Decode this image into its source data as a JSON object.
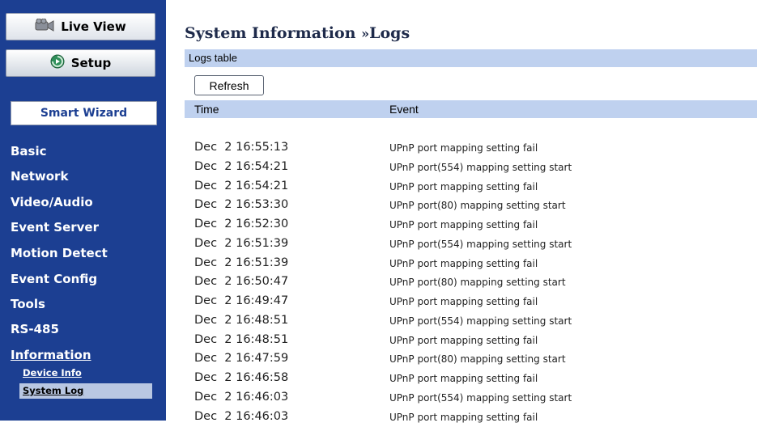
{
  "sidebar": {
    "live_view": "Live View",
    "setup": "Setup",
    "smart_wizard": "Smart Wizard",
    "nav": {
      "basic": "Basic",
      "network": "Network",
      "video_audio": "Video/Audio",
      "event_server": "Event Server",
      "motion_detect": "Motion Detect",
      "event_config": "Event Config",
      "tools": "Tools",
      "rs485": "RS-485",
      "information": "Information"
    },
    "sub": {
      "device_info": "Device Info",
      "system_log": "System Log"
    }
  },
  "main": {
    "title_section": "System Information",
    "title_sep": "»",
    "title_page": "Logs",
    "table_title": "Logs table",
    "refresh": "Refresh",
    "col_time": "Time",
    "col_event": "Event",
    "logs": [
      {
        "time": "Dec  2 16:55:13",
        "event": "UPnP port mapping setting fail"
      },
      {
        "time": "Dec  2 16:54:21",
        "event": "UPnP port(554) mapping setting start"
      },
      {
        "time": "Dec  2 16:54:21",
        "event": "UPnP port mapping setting fail"
      },
      {
        "time": "Dec  2 16:53:30",
        "event": "UPnP port(80) mapping setting start"
      },
      {
        "time": "Dec  2 16:52:30",
        "event": "UPnP port mapping setting fail"
      },
      {
        "time": "Dec  2 16:51:39",
        "event": "UPnP port(554) mapping setting start"
      },
      {
        "time": "Dec  2 16:51:39",
        "event": "UPnP port mapping setting fail"
      },
      {
        "time": "Dec  2 16:50:47",
        "event": "UPnP port(80) mapping setting start"
      },
      {
        "time": "Dec  2 16:49:47",
        "event": "UPnP port mapping setting fail"
      },
      {
        "time": "Dec  2 16:48:51",
        "event": "UPnP port(554) mapping setting start"
      },
      {
        "time": "Dec  2 16:48:51",
        "event": "UPnP port mapping setting fail"
      },
      {
        "time": "Dec  2 16:47:59",
        "event": "UPnP port(80) mapping setting start"
      },
      {
        "time": "Dec  2 16:46:58",
        "event": "UPnP port mapping setting fail"
      },
      {
        "time": "Dec  2 16:46:03",
        "event": "UPnP port(554) mapping setting start"
      },
      {
        "time": "Dec  2 16:46:03",
        "event": "UPnP port mapping setting fail"
      }
    ]
  }
}
